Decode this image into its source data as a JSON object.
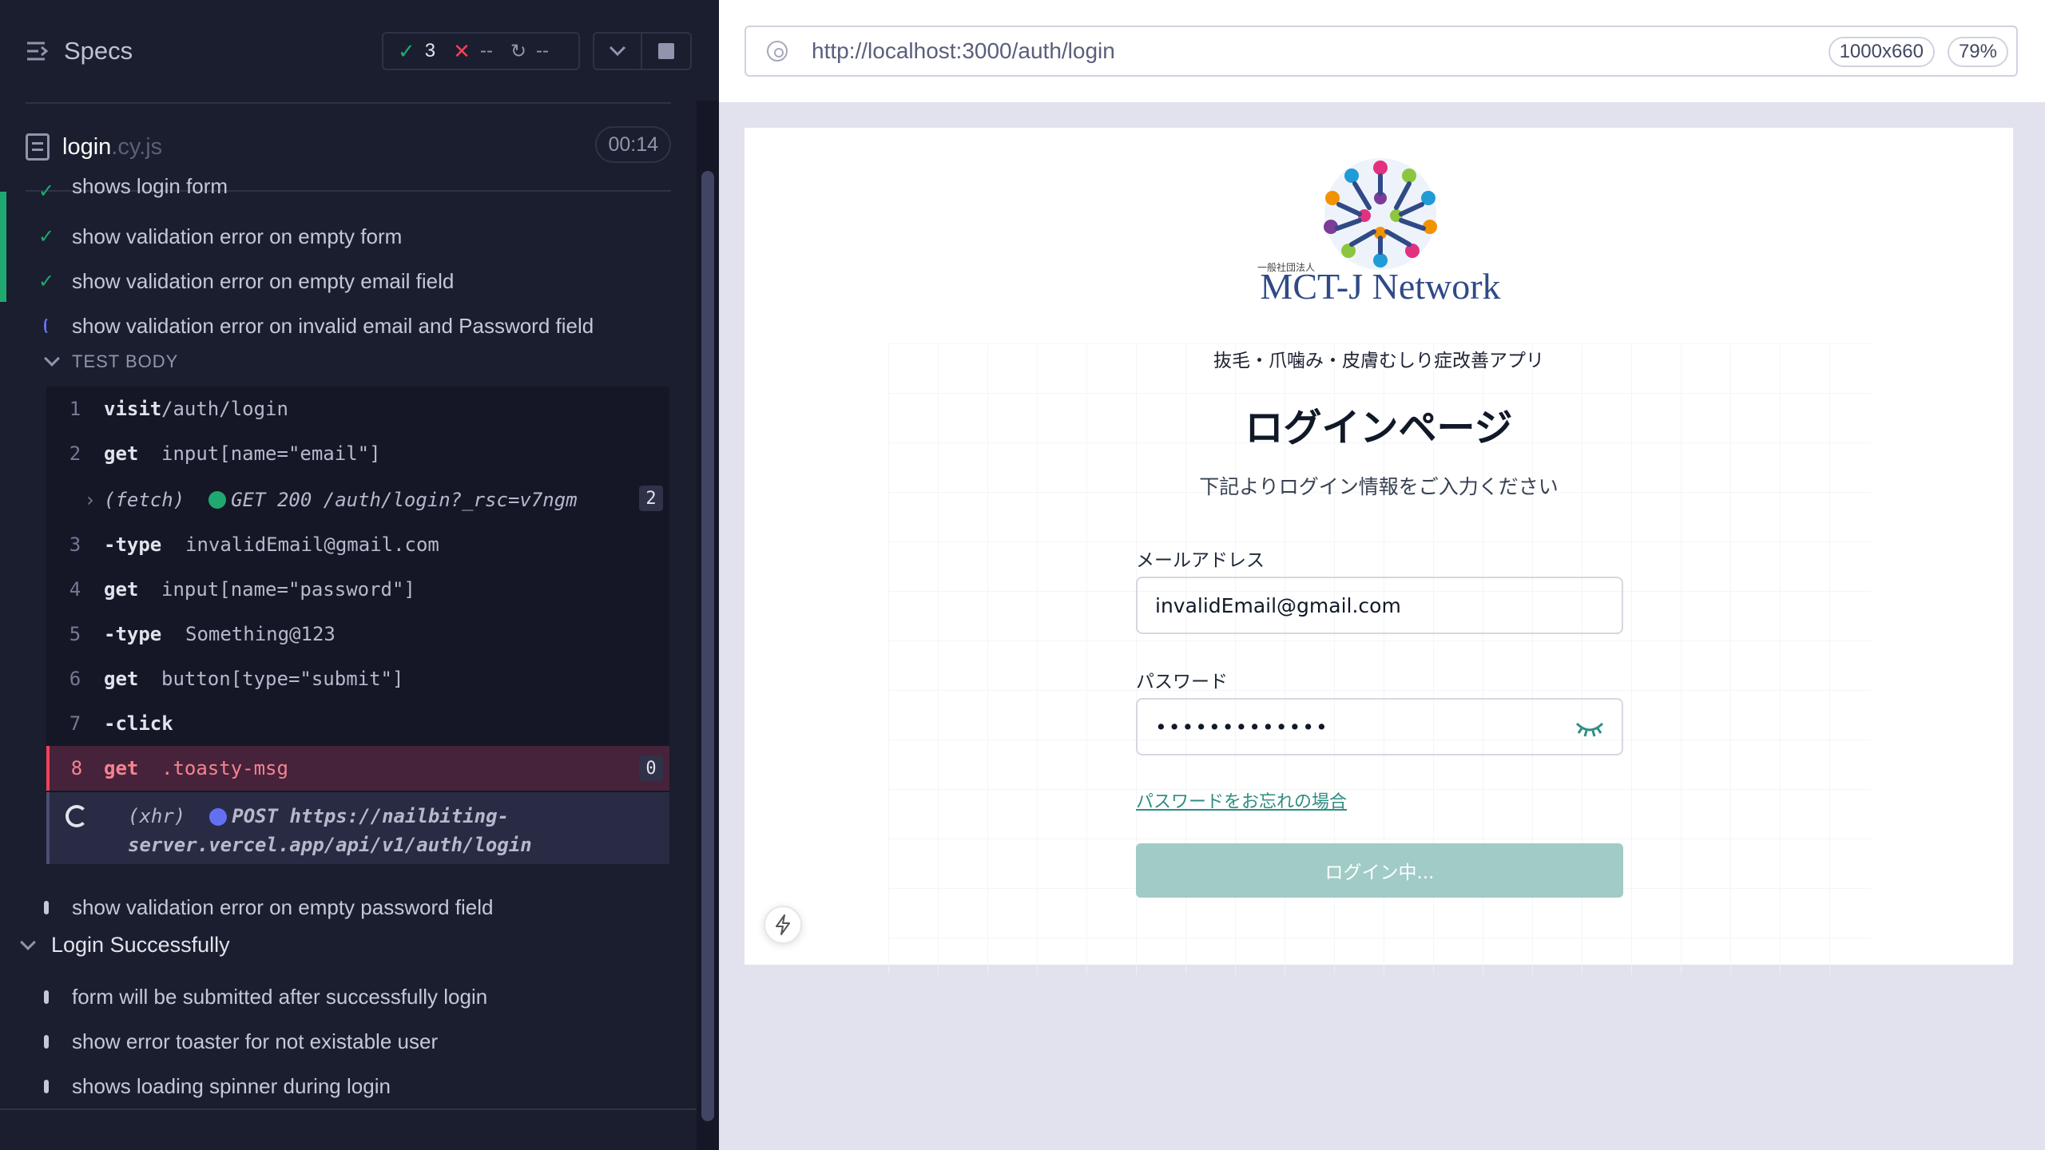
{
  "reporter": {
    "title": "Specs",
    "stats": {
      "passed": "3",
      "failed": "--",
      "pending": "--"
    },
    "file": {
      "name": "login",
      "ext": ".cy.js",
      "duration": "00:14"
    },
    "tests_before": [
      {
        "label": "shows login form",
        "state": "passed"
      },
      {
        "label": "show validation error on empty form",
        "state": "passed"
      },
      {
        "label": "show validation error on empty email field",
        "state": "passed"
      },
      {
        "label": "show validation error on invalid email and Password field",
        "state": "running"
      }
    ],
    "section_label": "TEST BODY",
    "commands": [
      {
        "num": "1",
        "name": "visit",
        "arg": "/auth/login"
      },
      {
        "num": "2",
        "name": "get",
        "arg": "input[name=\"email\"]"
      },
      {
        "num": "3",
        "name": "-type",
        "arg": "invalidEmail@gmail.com"
      },
      {
        "num": "4",
        "name": "get",
        "arg": "input[name=\"password\"]"
      },
      {
        "num": "5",
        "name": "-type",
        "arg": "Something@123"
      },
      {
        "num": "6",
        "name": "get",
        "arg": "button[type=\"submit\"]"
      },
      {
        "num": "7",
        "name": "-click",
        "arg": ""
      },
      {
        "num": "8",
        "name": "get",
        "arg": ".toasty-msg",
        "badge": "0"
      }
    ],
    "fetch": {
      "kind": "(fetch)",
      "text": "GET 200 /auth/login?_rsc=v7ngm",
      "badge": "2"
    },
    "xhr": {
      "kind": "(xhr)",
      "line1": "POST https://nailbiting-",
      "line2": "server.vercel.app/api/v1/auth/login"
    },
    "test_after": "show validation error on empty password field",
    "group": "Login Successfully",
    "group_tests": [
      "form will be submitted after successfully login",
      "show error toaster for not existable user",
      "shows loading spinner during login"
    ]
  },
  "aut": {
    "url": "http://localhost:3000/auth/login",
    "viewport_size": "1000x660",
    "zoom": "79%",
    "page": {
      "logo_small": "一般社団法人",
      "logo_text": "MCT-J Network",
      "app_subtitle": "抜毛・爪噛み・皮膚むしり症改善アプリ",
      "title": "ログインページ",
      "description": "下記よりログイン情報をご入力ください",
      "email_label": "メールアドレス",
      "email_value": "invalidEmail@gmail.com",
      "password_label": "パスワード",
      "password_value": "•••••••••••••",
      "forgot_link": "パスワードをお忘れの場合",
      "login_button": "ログイン中..."
    }
  },
  "colors": {
    "pass": "#1fa971",
    "fail": "#f14159",
    "running": "#6470f3",
    "accent_teal": "#a1cbc6"
  }
}
